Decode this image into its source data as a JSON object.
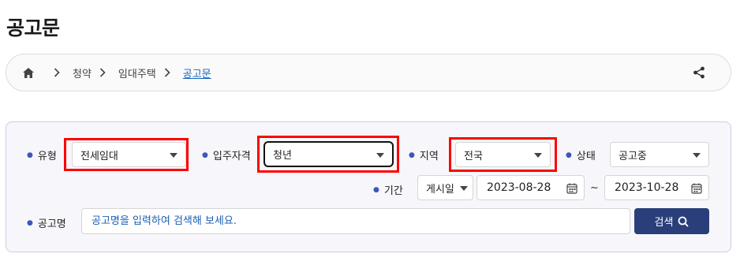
{
  "page": {
    "title": "공고문"
  },
  "breadcrumb": {
    "home_icon": "home-icon",
    "items": [
      "청약",
      "임대주택"
    ],
    "current": "공고문",
    "share_icon": "share-icon"
  },
  "filters": {
    "type": {
      "label": "유형",
      "value": "전세임대"
    },
    "eligibility": {
      "label": "입주자격",
      "value": "청년"
    },
    "region": {
      "label": "지역",
      "value": "전국"
    },
    "status": {
      "label": "상태",
      "value": "공고중"
    },
    "period": {
      "label": "기간",
      "basis": "게시일",
      "start": "2023-08-28",
      "separator": "~",
      "end": "2023-10-28"
    },
    "keyword": {
      "label": "공고명",
      "placeholder": "공고명을 입력하여 검색해 보세요.",
      "value": ""
    },
    "search_button": "검색"
  },
  "colors": {
    "highlight": "#ff0000",
    "accent": "#2a3f7a",
    "link": "#1565c0"
  }
}
